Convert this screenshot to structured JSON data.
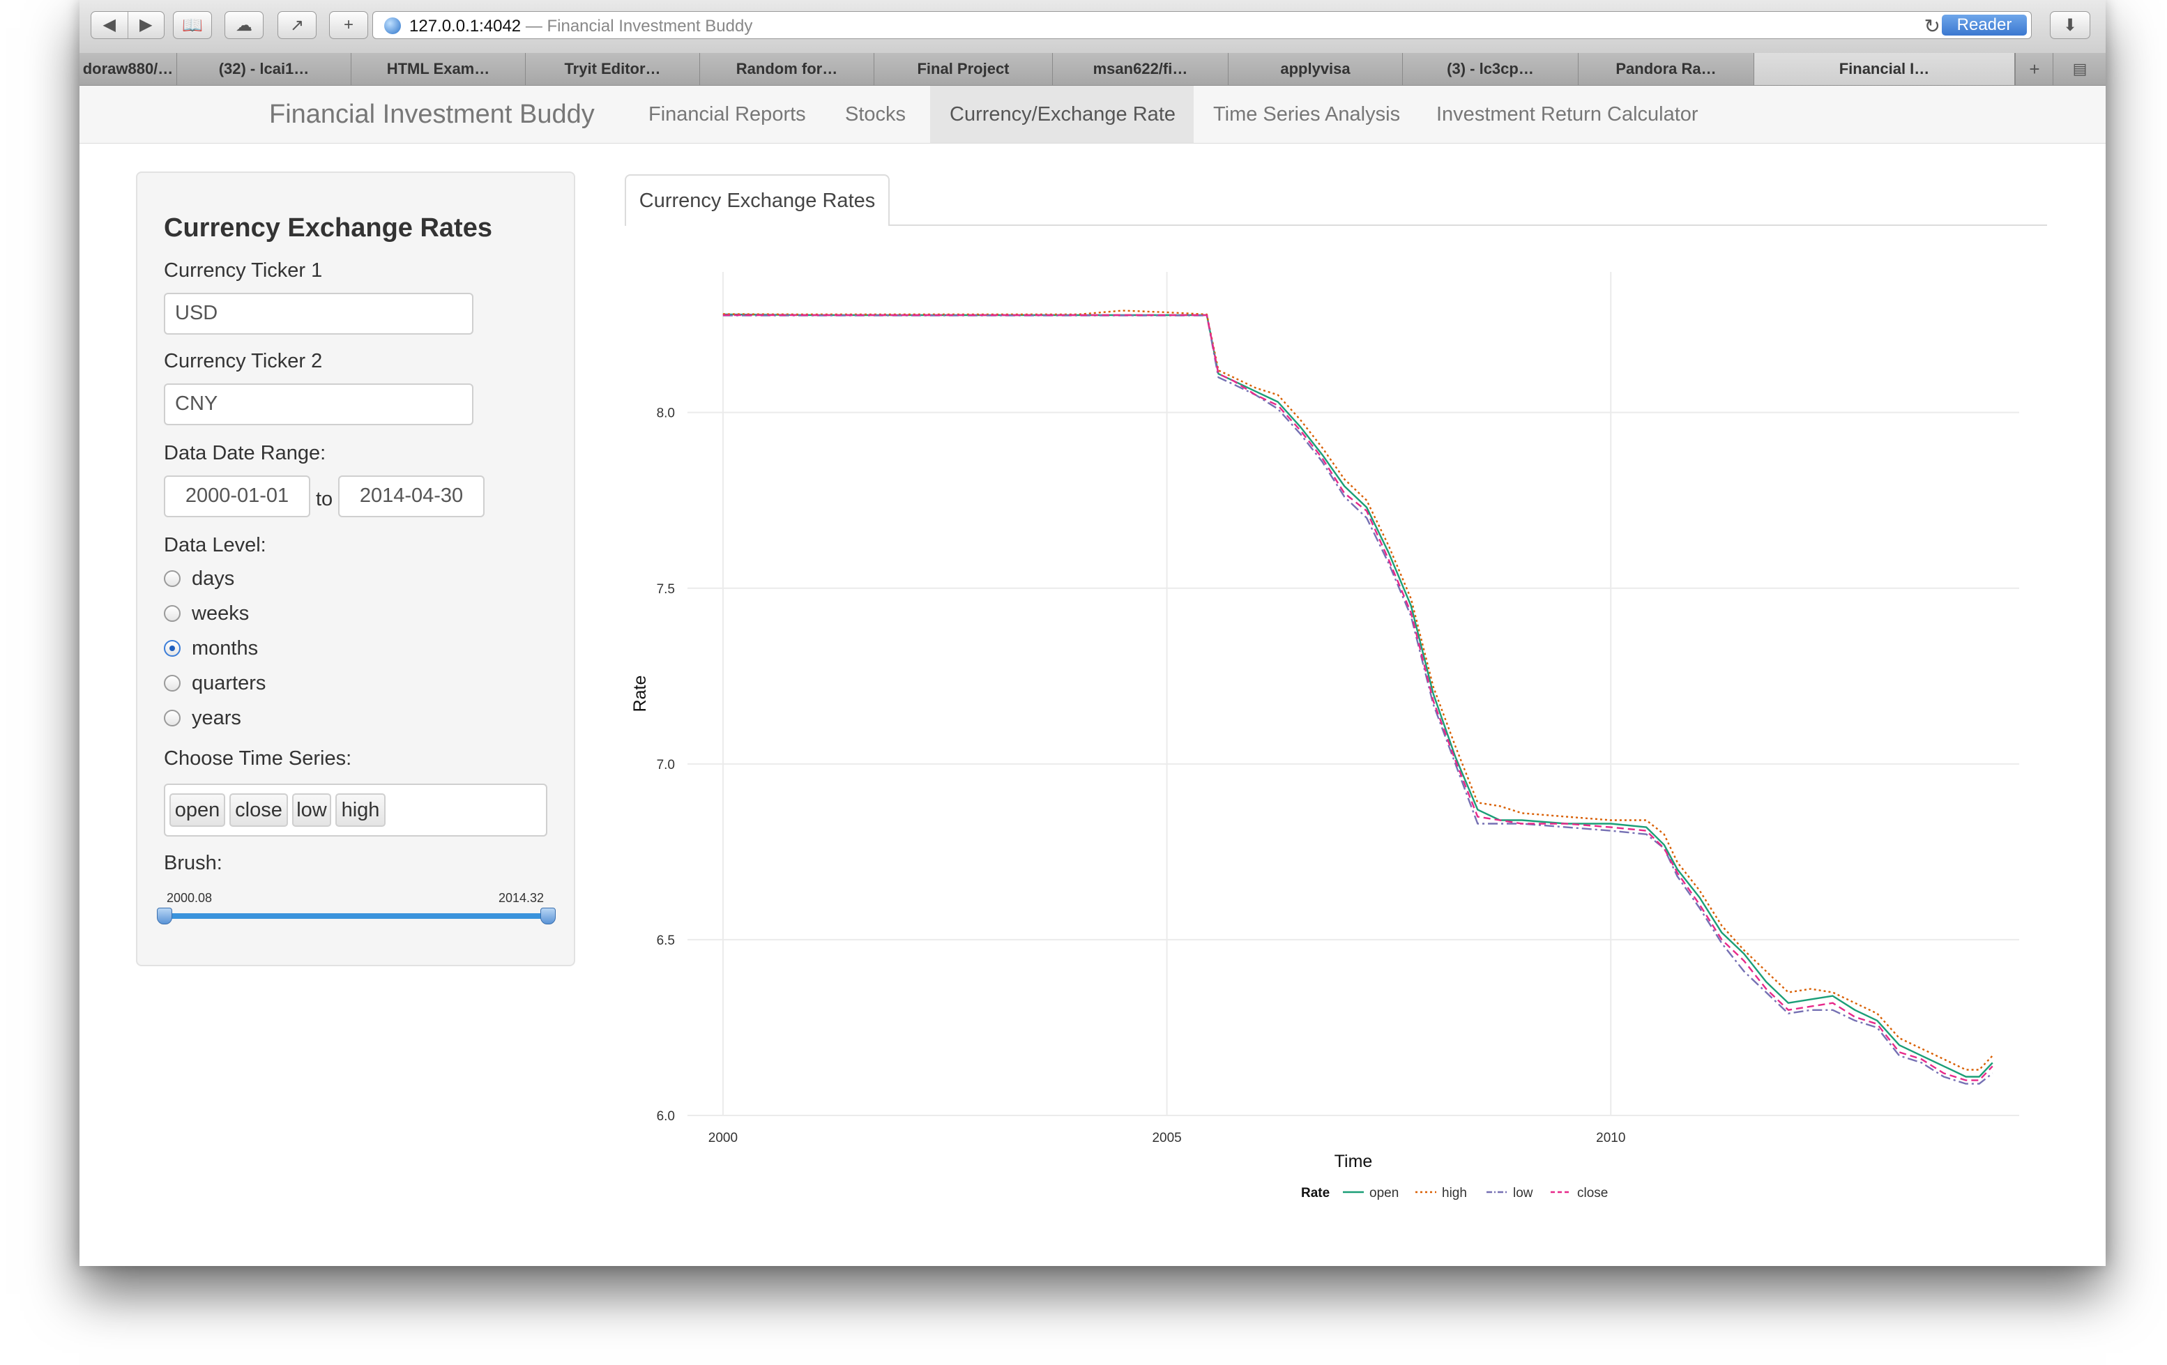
{
  "browser": {
    "url": "127.0.0.1:4042",
    "url_title": " — Financial Investment Buddy",
    "reader_label": "Reader",
    "tabs": [
      "doraw880/…",
      "(32) - lcai1…",
      "HTML Exam…",
      "Tryit Editor…",
      "Random for…",
      "Final Project",
      "msan622/fi…",
      "applyvisa",
      "(3) - lc3cp…",
      "Pandora Ra…",
      "Financial I…"
    ]
  },
  "navbar": {
    "brand": "Financial Investment Buddy",
    "items": [
      "Financial Reports",
      "Stocks",
      "Currency/Exchange Rate",
      "Time Series Analysis",
      "Investment Return Calculator"
    ],
    "active": "Currency/Exchange Rate"
  },
  "sidebar": {
    "title": "Currency Exchange Rates",
    "ticker1_label": "Currency Ticker 1",
    "ticker1_value": "USD",
    "ticker2_label": "Currency Ticker 2",
    "ticker2_value": "CNY",
    "date_range_label": "Data Date Range:",
    "date_start": "2000-01-01",
    "date_to": "to",
    "date_end": "2014-04-30",
    "level_label": "Data Level:",
    "levels": [
      "days",
      "weeks",
      "months",
      "quarters",
      "years"
    ],
    "selected_level": "months",
    "series_label": "Choose Time Series:",
    "series_chips": [
      "open",
      "close",
      "low",
      "high"
    ],
    "brush_label": "Brush:",
    "brush_min": "2000.08",
    "brush_max": "2014.32"
  },
  "main": {
    "tab_label": "Currency Exchange Rates"
  },
  "chart_data": {
    "type": "line",
    "xlabel": "Time",
    "ylabel": "Rate",
    "xlim": [
      1999.6,
      2014.6
    ],
    "ylim": [
      6.0,
      8.4
    ],
    "x_ticks": [
      2000,
      2005,
      2010
    ],
    "y_ticks": [
      6.0,
      6.5,
      7.0,
      7.5,
      8.0
    ],
    "y_tick_labels": [
      "6.0",
      "6.5",
      "7.0",
      "7.5",
      "8.0"
    ],
    "grid": true,
    "legend": {
      "title": "Rate",
      "position": "bottom"
    },
    "x": [
      2000.0,
      2001.0,
      2002.0,
      2003.0,
      2004.0,
      2004.5,
      2005.0,
      2005.45,
      2005.58,
      2005.75,
      2006.0,
      2006.25,
      2006.5,
      2006.75,
      2007.0,
      2007.25,
      2007.5,
      2007.75,
      2008.0,
      2008.25,
      2008.5,
      2008.75,
      2009.0,
      2009.5,
      2010.0,
      2010.4,
      2010.6,
      2010.75,
      2011.0,
      2011.25,
      2011.5,
      2011.75,
      2012.0,
      2012.25,
      2012.5,
      2012.75,
      2013.0,
      2013.25,
      2013.5,
      2013.75,
      2014.0,
      2014.15,
      2014.3
    ],
    "series": [
      {
        "name": "open",
        "color": "#1b9e77",
        "dash": "",
        "values": [
          8.279,
          8.277,
          8.277,
          8.277,
          8.277,
          8.277,
          8.277,
          8.277,
          8.11,
          8.09,
          8.06,
          8.03,
          7.96,
          7.88,
          7.79,
          7.73,
          7.6,
          7.45,
          7.2,
          7.02,
          6.87,
          6.84,
          6.84,
          6.83,
          6.83,
          6.82,
          6.77,
          6.7,
          6.62,
          6.52,
          6.46,
          6.38,
          6.32,
          6.33,
          6.34,
          6.3,
          6.27,
          6.2,
          6.17,
          6.14,
          6.11,
          6.11,
          6.15
        ]
      },
      {
        "name": "high",
        "color": "#d95f02",
        "dash": "3 4",
        "values": [
          8.28,
          8.279,
          8.279,
          8.279,
          8.279,
          8.29,
          8.285,
          8.279,
          8.12,
          8.1,
          8.07,
          8.05,
          7.98,
          7.9,
          7.81,
          7.75,
          7.62,
          7.47,
          7.22,
          7.05,
          6.89,
          6.88,
          6.86,
          6.85,
          6.84,
          6.84,
          6.8,
          6.72,
          6.64,
          6.54,
          6.47,
          6.41,
          6.35,
          6.36,
          6.35,
          6.32,
          6.29,
          6.22,
          6.19,
          6.16,
          6.13,
          6.13,
          6.17
        ]
      },
      {
        "name": "low",
        "color": "#7570b3",
        "dash": "14 5 3 5",
        "values": [
          8.276,
          8.276,
          8.276,
          8.276,
          8.276,
          8.276,
          8.276,
          8.276,
          8.1,
          8.08,
          8.05,
          8.01,
          7.94,
          7.86,
          7.76,
          7.7,
          7.57,
          7.42,
          7.17,
          7.0,
          6.83,
          6.83,
          6.83,
          6.82,
          6.81,
          6.8,
          6.76,
          6.68,
          6.59,
          6.49,
          6.41,
          6.35,
          6.29,
          6.3,
          6.3,
          6.27,
          6.25,
          6.17,
          6.15,
          6.11,
          6.09,
          6.09,
          6.12
        ]
      },
      {
        "name": "close",
        "color": "#e7298a",
        "dash": "10 6",
        "values": [
          8.277,
          8.277,
          8.277,
          8.277,
          8.277,
          8.277,
          8.277,
          8.277,
          8.11,
          8.09,
          8.05,
          8.02,
          7.95,
          7.87,
          7.77,
          7.72,
          7.58,
          7.43,
          7.18,
          7.01,
          6.85,
          6.84,
          6.83,
          6.83,
          6.82,
          6.81,
          6.76,
          6.69,
          6.6,
          6.5,
          6.44,
          6.36,
          6.3,
          6.31,
          6.32,
          6.28,
          6.26,
          6.18,
          6.16,
          6.12,
          6.1,
          6.1,
          6.14
        ]
      }
    ]
  }
}
